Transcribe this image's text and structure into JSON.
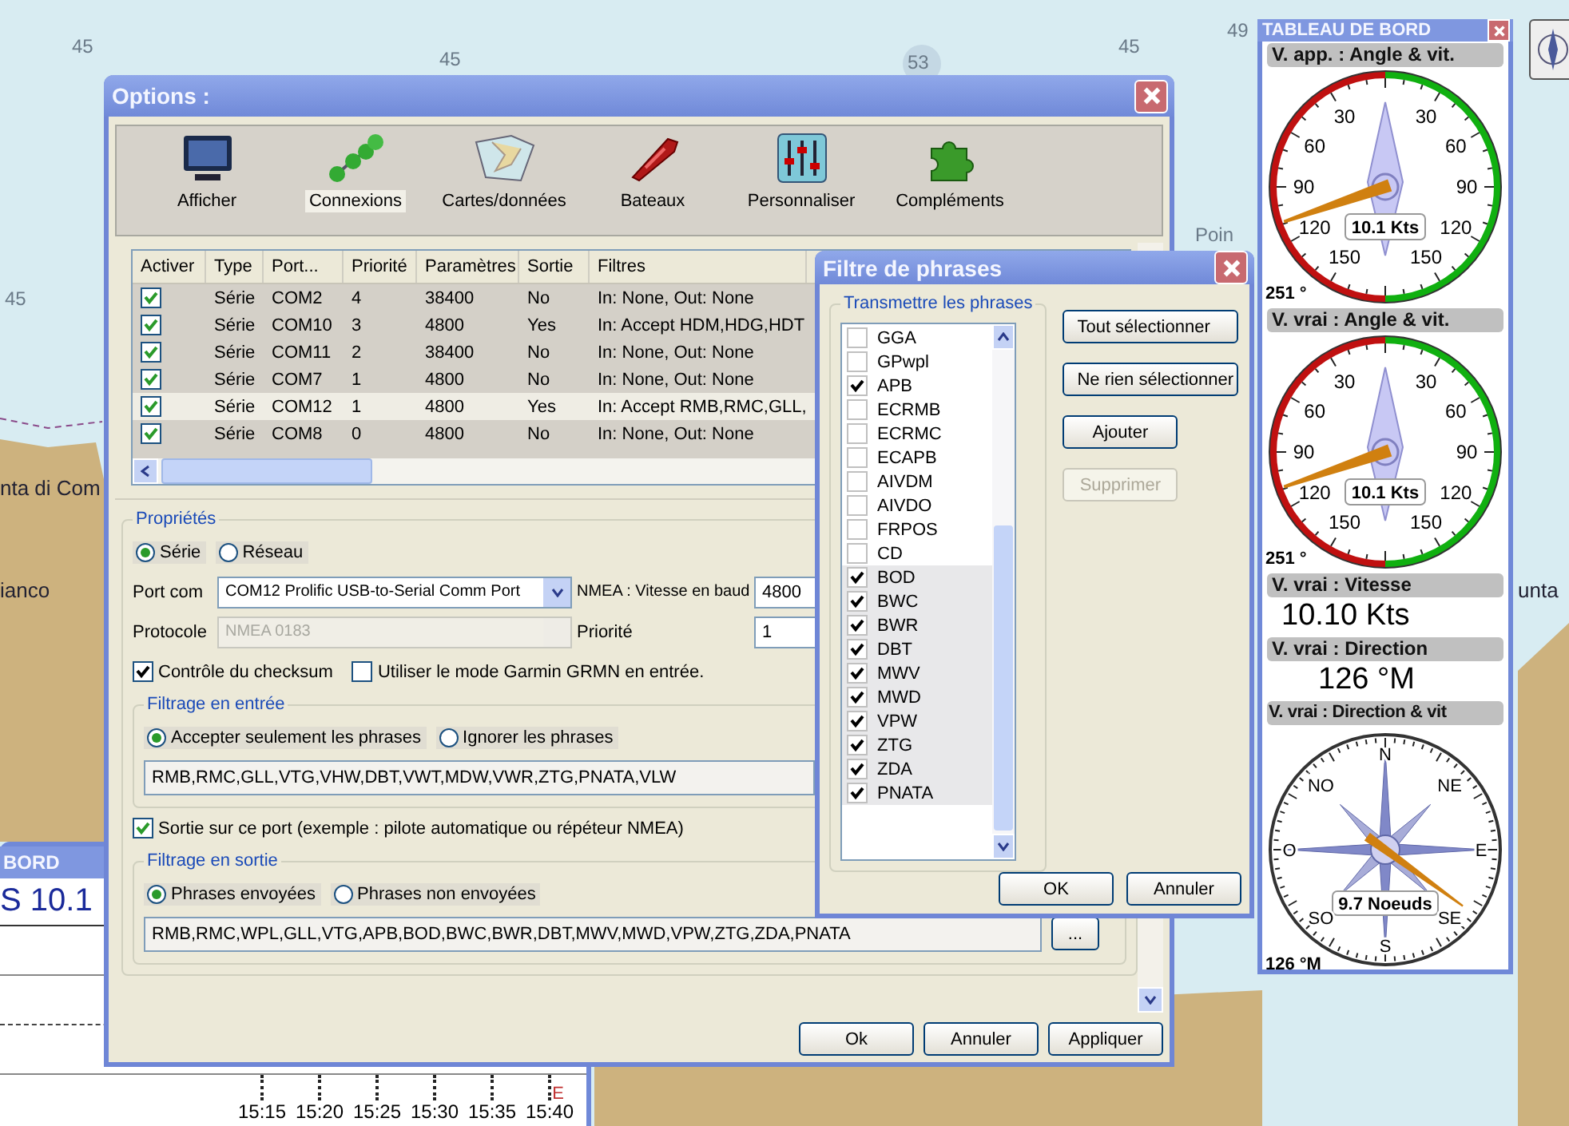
{
  "map": {
    "labels": [
      "45",
      "45",
      "53",
      "45",
      "49",
      "45",
      "Poin",
      "nta di Com",
      "ianco",
      "unta"
    ]
  },
  "options": {
    "title": "Options :",
    "tabs": [
      {
        "kind": "display",
        "label": "Afficher",
        "selected": false
      },
      {
        "kind": "connections",
        "label": "Connexions",
        "selected": true
      },
      {
        "kind": "charts",
        "label": "Cartes/données",
        "selected": false
      },
      {
        "kind": "boats",
        "label": "Bateaux",
        "selected": false
      },
      {
        "kind": "settings",
        "label": "Personnaliser",
        "selected": false
      },
      {
        "kind": "plugins",
        "label": "Compléments",
        "selected": false
      }
    ],
    "table": {
      "columns": [
        "Activer",
        "Type",
        "Port...",
        "Priorité",
        "Paramètres",
        "Sortie",
        "Filtres"
      ],
      "rows": [
        {
          "enabled": true,
          "selected": false,
          "type": "Série",
          "port": "COM2",
          "priority": "4",
          "parameters": "38400",
          "output": "No",
          "filters": "In: None, Out: None"
        },
        {
          "enabled": true,
          "selected": false,
          "type": "Série",
          "port": "COM10",
          "priority": "3",
          "parameters": "4800",
          "output": "Yes",
          "filters": "In: Accept HDM,HDG,HDT"
        },
        {
          "enabled": true,
          "selected": false,
          "type": "Série",
          "port": "COM11",
          "priority": "2",
          "parameters": "38400",
          "output": "No",
          "filters": "In: None, Out: None"
        },
        {
          "enabled": true,
          "selected": false,
          "type": "Série",
          "port": "COM7",
          "priority": "1",
          "parameters": "4800",
          "output": "No",
          "filters": "In: None, Out: None"
        },
        {
          "enabled": true,
          "selected": true,
          "type": "Série",
          "port": "COM12",
          "priority": "1",
          "parameters": "4800",
          "output": "Yes",
          "filters": "In: Accept RMB,RMC,GLL,"
        },
        {
          "enabled": true,
          "selected": false,
          "type": "Série",
          "port": "COM8",
          "priority": "0",
          "parameters": "4800",
          "output": "No",
          "filters": "In: None, Out: None"
        }
      ]
    },
    "properties": {
      "title": "Propriétés",
      "type_options": [
        {
          "label": "Série",
          "selected": true
        },
        {
          "label": "Réseau",
          "selected": false
        }
      ],
      "port_label": "Port com",
      "port_value": "COM12 Prolific USB-to-Serial Comm Port",
      "baud_label": "NMEA : Vitesse en baud",
      "baud_value": "4800",
      "protocol_label": "Protocole",
      "protocol_value": "NMEA 0183",
      "protocol_disabled": true,
      "priority_label": "Priorité",
      "priority_value": "1",
      "checksum": {
        "label": "Contrôle du checksum",
        "checked": true
      },
      "garmin": {
        "label": "Utiliser le mode Garmin GRMN en entrée.",
        "checked": false
      },
      "input_filter": {
        "title": "Filtrage en entrée",
        "options": [
          {
            "label": "Accepter seulement les phrases",
            "selected": true
          },
          {
            "label": "Ignorer les phrases",
            "selected": false
          }
        ],
        "value": "RMB,RMC,GLL,VTG,VHW,DBT,VWT,MDW,VWR,ZTG,PNATA,VLW"
      },
      "output_port": {
        "label": "Sortie sur ce port (exemple : pilote automatique ou répéteur NMEA)",
        "checked": true
      },
      "output_filter": {
        "title": "Filtrage en sortie",
        "options": [
          {
            "label": "Phrases envoyées",
            "selected": true
          },
          {
            "label": "Phrases non envoyées",
            "selected": false
          }
        ],
        "value": "RMB,RMC,WPL,GLL,VTG,APB,BOD,BWC,BWR,DBT,MWV,MWD,VPW,ZTG,ZDA,PNATA",
        "browse": "..."
      }
    },
    "buttons": [
      "Ok",
      "Annuler",
      "Appliquer"
    ]
  },
  "filter_dialog": {
    "title": "Filtre de phrases",
    "group": "Transmettre les phrases",
    "sentences": [
      {
        "label": "GGA",
        "checked": false,
        "selected": false
      },
      {
        "label": "GPwpl",
        "checked": false,
        "selected": false
      },
      {
        "label": "APB",
        "checked": true,
        "selected": false
      },
      {
        "label": "ECRMB",
        "checked": false,
        "selected": false
      },
      {
        "label": "ECRMC",
        "checked": false,
        "selected": false
      },
      {
        "label": "ECAPB",
        "checked": false,
        "selected": false
      },
      {
        "label": "AIVDM",
        "checked": false,
        "selected": false
      },
      {
        "label": "AIVDO",
        "checked": false,
        "selected": false
      },
      {
        "label": "FRPOS",
        "checked": false,
        "selected": false
      },
      {
        "label": "CD",
        "checked": false,
        "selected": false
      },
      {
        "label": "BOD",
        "checked": true,
        "selected": true
      },
      {
        "label": "BWC",
        "checked": true,
        "selected": true
      },
      {
        "label": "BWR",
        "checked": true,
        "selected": true
      },
      {
        "label": "DBT",
        "checked": true,
        "selected": true
      },
      {
        "label": "MWV",
        "checked": true,
        "selected": true
      },
      {
        "label": "MWD",
        "checked": true,
        "selected": true
      },
      {
        "label": "VPW",
        "checked": true,
        "selected": true
      },
      {
        "label": "ZTG",
        "checked": true,
        "selected": true
      },
      {
        "label": "ZDA",
        "checked": true,
        "selected": true
      },
      {
        "label": "PNATA",
        "checked": true,
        "selected": true
      }
    ],
    "side_buttons": [
      {
        "label": "Tout sélectionner",
        "disabled": false
      },
      {
        "label": "Ne rien sélectionner",
        "disabled": false
      },
      {
        "label": "Ajouter",
        "disabled": false
      },
      {
        "label": "Supprimer",
        "disabled": true
      }
    ],
    "buttons": [
      "OK",
      "Annuler"
    ]
  },
  "dashboard": {
    "title": "TABLEAU DE BORD",
    "instruments": [
      {
        "kind": "wind_gauge",
        "title": "V. app. : Angle & vit.",
        "left_labels": [
          "30",
          "60",
          "90",
          "120",
          "150"
        ],
        "right_labels": [
          "30",
          "60",
          "90",
          "120",
          "150"
        ],
        "value": "10.1 Kts",
        "reading": "251 °"
      },
      {
        "kind": "wind_gauge",
        "title": "V. vrai : Angle & vit.",
        "left_labels": [
          "30",
          "60",
          "90",
          "120",
          "150"
        ],
        "right_labels": [
          "30",
          "60",
          "90",
          "120",
          "150"
        ],
        "value": "10.1 Kts",
        "reading": "251 °"
      },
      {
        "kind": "text",
        "title": "V. vrai : Vitesse",
        "value": "10.10 Kts"
      },
      {
        "kind": "text",
        "title": "V. vrai : Direction",
        "value": "126 °M"
      },
      {
        "kind": "compass",
        "title": "V. vrai : Direction & vit",
        "labels": [
          "N",
          "NE",
          "E",
          "SE",
          "S",
          "SO",
          "O",
          "NO"
        ],
        "value": "9.7 Noeuds",
        "reading": "126 °M"
      }
    ]
  },
  "chart_window": {
    "title": "BORD",
    "value": "S 10.1",
    "time_labels": [
      "15:15",
      "15:20",
      "15:25",
      "15:30",
      "15:35",
      "15:40"
    ],
    "marker": "E"
  }
}
